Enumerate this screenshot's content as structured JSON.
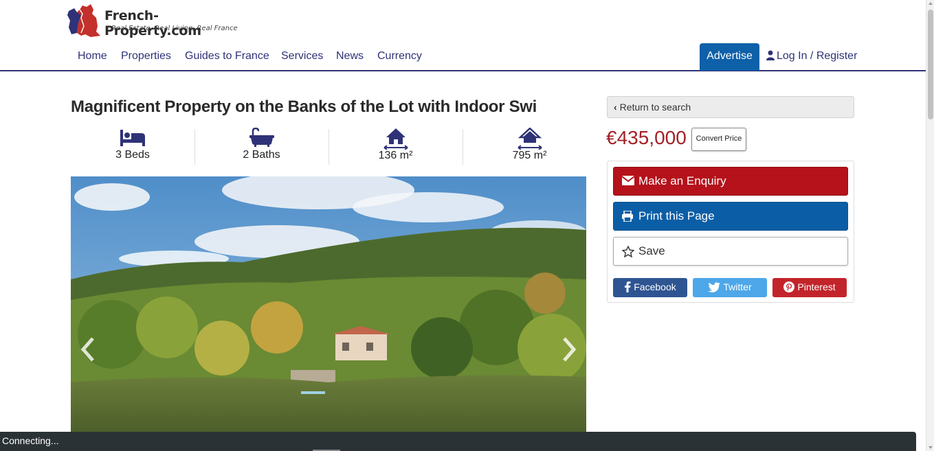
{
  "site": {
    "logo_name": "French-Property.com",
    "logo_tagline": "Real Estate, Real Living, Real France",
    "brand_blue": "#2f3277",
    "brand_red": "#c4302b"
  },
  "nav": {
    "items": [
      {
        "label": "Home"
      },
      {
        "label": "Properties"
      },
      {
        "label": "Guides to France"
      },
      {
        "label": "Services"
      },
      {
        "label": "News"
      },
      {
        "label": "Currency"
      }
    ],
    "advertise": "Advertise",
    "login": "Log In / Register"
  },
  "listing": {
    "title": "Magnificent Property on the Banks of the Lot with Indoor Swi",
    "features": [
      {
        "icon": "bed-icon",
        "label": "3 Beds"
      },
      {
        "icon": "bath-icon",
        "label": "2 Baths"
      },
      {
        "icon": "house-area-icon",
        "label": "136 m²"
      },
      {
        "icon": "land-area-icon",
        "label": "795 m²"
      }
    ],
    "gallery": {
      "prev_icon": "chevron-left-icon",
      "next_icon": "chevron-right-icon"
    }
  },
  "sidebar": {
    "return_label": "Return to search",
    "price": "€435,000",
    "convert_label": "Convert Price",
    "actions": {
      "enquiry": "Make an Enquiry",
      "print": "Print this Page",
      "save": "Save"
    },
    "share": {
      "facebook": "Facebook",
      "twitter": "Twitter",
      "pinterest": "Pinterest"
    }
  },
  "status": {
    "text": "Connecting..."
  },
  "colors": {
    "price": "#a31f24",
    "enquiry": "#b5121b",
    "print": "#0b5ea6",
    "advertise": "#0e60a8",
    "facebook": "#2e5592",
    "twitter": "#4da7e8",
    "pinterest": "#c3242b"
  }
}
